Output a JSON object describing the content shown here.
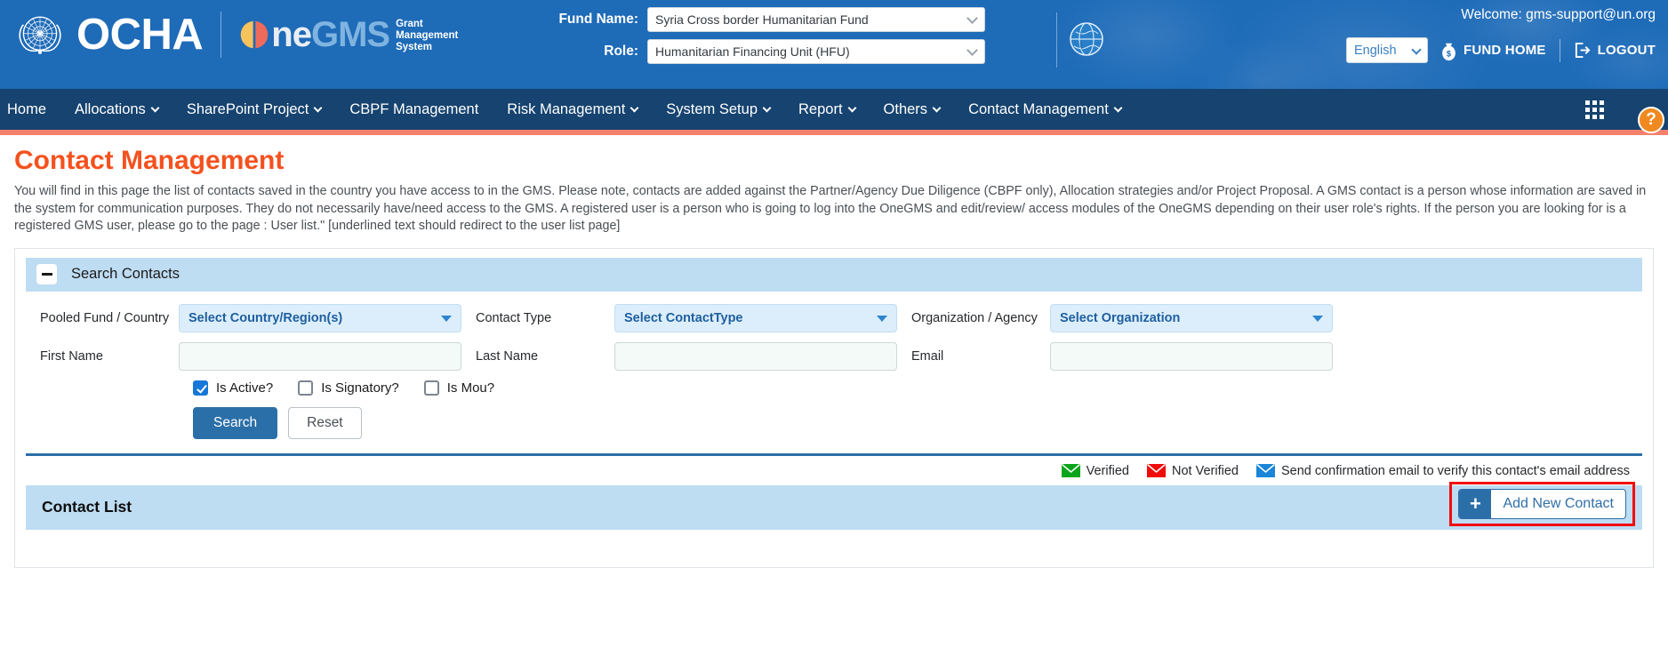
{
  "banner": {
    "ocha_label": "OCHA",
    "brand_o": "O",
    "brand_ne": "ne",
    "brand_gms": "GMS",
    "brand_sub_line1": "Grant",
    "brand_sub_line2": "Management",
    "brand_sub_line3": "System",
    "fund_name_label": "Fund Name:",
    "fund_name_value": "Syria Cross border Humanitarian Fund",
    "role_label": "Role:",
    "role_value": "Humanitarian Financing Unit (HFU)",
    "welcome": "Welcome: gms-support@un.org",
    "language_value": "English",
    "fund_home_label": "FUND HOME",
    "logout_label": "LOGOUT"
  },
  "nav": {
    "items": [
      {
        "label": "Home",
        "caret": false
      },
      {
        "label": "Allocations",
        "caret": true
      },
      {
        "label": "SharePoint Project",
        "caret": true
      },
      {
        "label": "CBPF Management",
        "caret": false
      },
      {
        "label": "Risk Management",
        "caret": true
      },
      {
        "label": "System Setup",
        "caret": true
      },
      {
        "label": "Report",
        "caret": true
      },
      {
        "label": "Others",
        "caret": true
      },
      {
        "label": "Contact Management",
        "caret": true
      }
    ],
    "help_label": "?"
  },
  "page": {
    "title": "Contact Management",
    "description": "You will find in this page the list of contacts saved in the country you have access to in the GMS. Please note, contacts are added against the Partner/Agency Due Diligence (CBPF only), Allocation strategies and/or Project Proposal. A GMS contact is a person whose information are saved in the system for communication purposes. They do not necessarily have/need access to the GMS. A registered user is a person who is going to log into the OneGMS and edit/review/ access modules of the OneGMS depending on their user role's rights. If the person you are looking for is a registered GMS user, please go to the page : User list.\" [underlined text should redirect to the user list page]"
  },
  "search_panel": {
    "title": "Search Contacts",
    "fields": {
      "pooled_fund_label": "Pooled Fund / Country",
      "pooled_fund_value": "Select Country/Region(s)",
      "contact_type_label": "Contact Type",
      "contact_type_value": "Select ContactType",
      "organization_label": "Organization / Agency",
      "organization_value": "Select Organization",
      "first_name_label": "First Name",
      "first_name_value": "",
      "last_name_label": "Last Name",
      "last_name_value": "",
      "email_label": "Email",
      "email_value": ""
    },
    "checkboxes": [
      {
        "label": "Is Active?",
        "checked": true
      },
      {
        "label": "Is Signatory?",
        "checked": false
      },
      {
        "label": "Is Mou?",
        "checked": false
      }
    ],
    "search_button": "Search",
    "reset_button": "Reset"
  },
  "legend": {
    "verified": "Verified",
    "not_verified": "Not Verified",
    "send_confirmation": "Send confirmation email to verify this contact's email address",
    "verified_color": "#0aa51b",
    "not_verified_color": "#f00a0a",
    "send_color": "#1a86d8"
  },
  "contact_list": {
    "title": "Contact List",
    "add_button_label": "Add New Contact",
    "add_button_plus": "+",
    "highlight_color": "#f20d0d"
  },
  "colors": {
    "banner_blue": "#1e6bb8",
    "nav_blue": "#16436f",
    "orange_rule": "#f4806c",
    "title_orange": "#f4511e",
    "panel_head_blue": "#bedcf2",
    "primary_button": "#2b6fa8"
  }
}
